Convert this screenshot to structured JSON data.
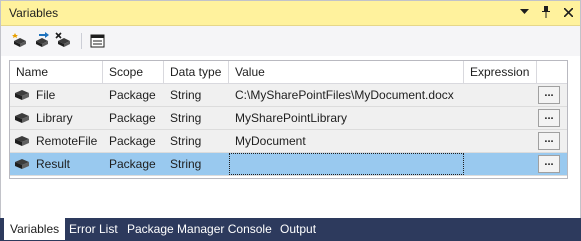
{
  "window": {
    "title": "Variables"
  },
  "title_controls": [
    "dropdown-icon",
    "pin-icon",
    "close-icon"
  ],
  "toolbar": {
    "buttons": [
      "add-variable-icon",
      "move-variable-icon",
      "delete-variable-icon",
      "grid-options-icon"
    ]
  },
  "columns": [
    "Name",
    "Scope",
    "Data type",
    "Value",
    "Expression"
  ],
  "rows": [
    {
      "name": "File",
      "scope": "Package",
      "type": "String",
      "value": "C:\\MySharePointFiles\\MyDocument.docx",
      "expression": "",
      "button": "..."
    },
    {
      "name": "Library",
      "scope": "Package",
      "type": "String",
      "value": "MySharePointLibrary",
      "expression": "",
      "button": "..."
    },
    {
      "name": "RemoteFile",
      "scope": "Package",
      "type": "String",
      "value": "MyDocument",
      "expression": "",
      "button": "..."
    },
    {
      "name": "Result",
      "scope": "Package",
      "type": "String",
      "value": "",
      "expression": "",
      "button": "...",
      "selected": true
    }
  ],
  "tabs": [
    "Variables",
    "Error List",
    "Package Manager Console",
    "Output"
  ],
  "colors": {
    "title_bg": "#fff29d",
    "selected_row": "#99c9ef",
    "tab_strip": "#2d3a5d"
  }
}
